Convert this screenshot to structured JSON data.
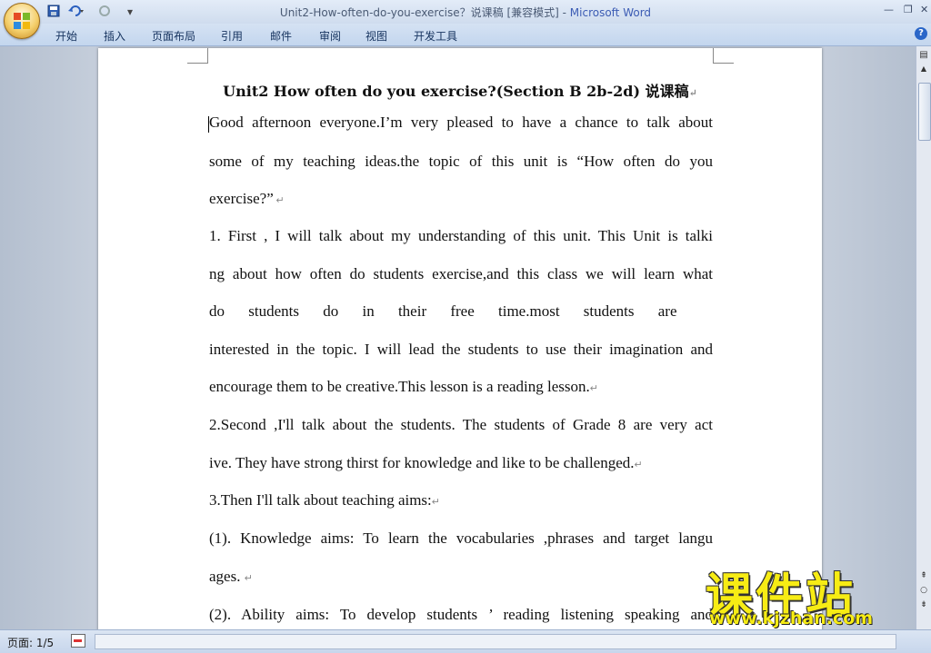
{
  "window": {
    "title": "Unit2-How-often-do-you-exercise？说课稿 [兼容模式] - ",
    "app_name": "Microsoft Word"
  },
  "ribbon": {
    "tabs": [
      "开始",
      "插入",
      "页面布局",
      "引用",
      "邮件",
      "审阅",
      "视图",
      "开发工具"
    ]
  },
  "document": {
    "title": "Unit2 How often do you exercise?(Section B 2b-2d)  说课稿",
    "lines": [
      "Good afternoon everyone.I’m very pleased to have a chance to talk about",
      "some of my teaching ideas.the topic of this unit is  “How often do you",
      "exercise?”",
      "1. First , I will talk about my understanding of this unit. This Unit is talki",
      "ng about how often do students exercise,and this class we will learn what",
      "do students do in their free time.most students are",
      "interested in the topic. I will lead the students to use their imagination and",
      " encourage them to be creative.This lesson is  a reading lesson.",
      "2.Second ,I'll talk about the students. The students of Grade 8 are very act",
      "ive. They have strong thirst for knowledge and like to be challenged.",
      "3.Then I'll talk about teaching aims:",
      "(1). Knowledge aims:  To learn the vocabularies ,phrases and target langu",
      "ages. ",
      "(2). Ability aims: To develop students ’   reading  listening speaking and"
    ]
  },
  "watermark": {
    "chinese": "课件站",
    "url": "www.kjzhan.com"
  },
  "statusbar": {
    "page": "页面: 1/5"
  },
  "icons": {
    "office_button": "office-logo-icon",
    "save": "save-icon",
    "undo": "undo-icon",
    "redo": "redo-icon",
    "help": "help-icon"
  }
}
